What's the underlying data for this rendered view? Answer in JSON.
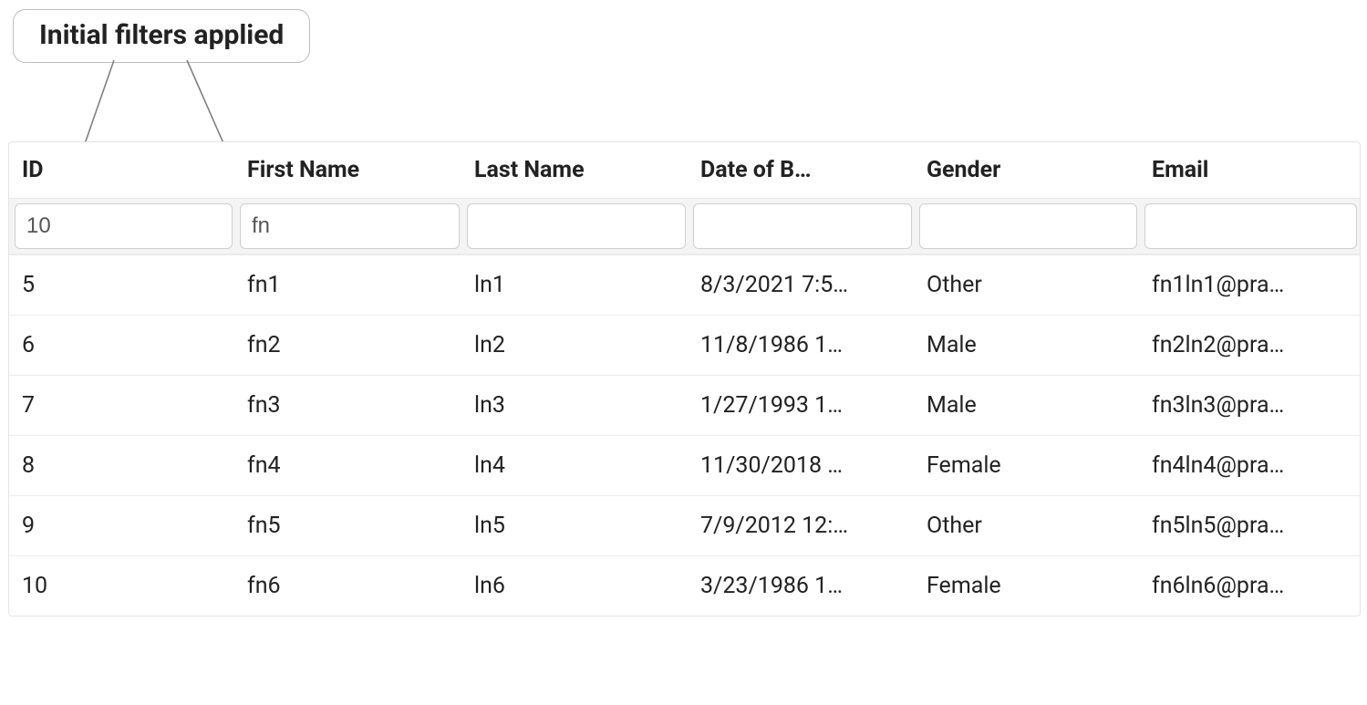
{
  "callout": {
    "text": "Initial filters applied"
  },
  "columns": [
    {
      "key": "id",
      "label": "ID"
    },
    {
      "key": "first",
      "label": "First Name"
    },
    {
      "key": "last",
      "label": "Last Name"
    },
    {
      "key": "dob",
      "label": "Date of B…"
    },
    {
      "key": "gender",
      "label": "Gender"
    },
    {
      "key": "email",
      "label": "Email"
    }
  ],
  "filters": {
    "id": "10",
    "first": "fn",
    "last": "",
    "dob": "",
    "gender": "",
    "email": ""
  },
  "rows": [
    {
      "id": "5",
      "first": "fn1",
      "last": "ln1",
      "dob": "8/3/2021 7:5…",
      "gender": "Other",
      "email": "fn1ln1@pra…"
    },
    {
      "id": "6",
      "first": "fn2",
      "last": "ln2",
      "dob": "11/8/1986 1…",
      "gender": "Male",
      "email": "fn2ln2@pra…"
    },
    {
      "id": "7",
      "first": "fn3",
      "last": "ln3",
      "dob": "1/27/1993 1…",
      "gender": "Male",
      "email": "fn3ln3@pra…"
    },
    {
      "id": "8",
      "first": "fn4",
      "last": "ln4",
      "dob": "11/30/2018 …",
      "gender": "Female",
      "email": "fn4ln4@pra…"
    },
    {
      "id": "9",
      "first": "fn5",
      "last": "ln5",
      "dob": "7/9/2012 12:…",
      "gender": "Other",
      "email": "fn5ln5@pra…"
    },
    {
      "id": "10",
      "first": "fn6",
      "last": "ln6",
      "dob": "3/23/1986 1…",
      "gender": "Female",
      "email": "fn6ln6@pra…"
    }
  ]
}
